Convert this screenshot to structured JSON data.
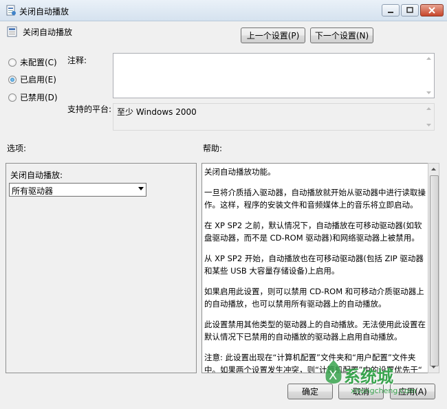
{
  "window": {
    "title": "关闭自动播放"
  },
  "header": {
    "title": "关闭自动播放",
    "prev_label": "上一个设置(P)",
    "next_label": "下一个设置(N)"
  },
  "state": {
    "options": [
      {
        "label": "未配置(C)",
        "checked": false
      },
      {
        "label": "已启用(E)",
        "checked": true
      },
      {
        "label": "已禁用(D)",
        "checked": false
      }
    ]
  },
  "comment": {
    "label": "注释:",
    "value": ""
  },
  "platform": {
    "label": "支持的平台:",
    "value": "至少 Windows 2000"
  },
  "options_section": {
    "label": "选项:",
    "field_label": "关闭自动播放:",
    "selected": "所有驱动器"
  },
  "help_section": {
    "label": "帮助:",
    "paragraphs": [
      "关闭自动播放功能。",
      "一旦将介质插入驱动器，自动播放就开始从驱动器中进行读取操作。这样，程序的安装文件和音频媒体上的音乐将立即启动。",
      "在 XP SP2 之前，默认情况下，自动播放在可移动驱动器(如软盘驱动器，而不是 CD-ROM 驱动器)和网络驱动器上被禁用。",
      "从 XP SP2 开始，自动播放也在可移动驱动器(包括 ZIP 驱动器和某些 USB 大容量存储设备)上启用。",
      "如果启用此设置，则可以禁用 CD-ROM 和可移动介质驱动器上的自动播放，也可以禁用所有驱动器上的自动播放。",
      "此设置禁用其他类型的驱动器上的自动播放。无法使用此设置在默认情况下已禁用的自动播放的驱动器上启用自动播放。",
      "注意: 此设置出现在“计算机配置”文件夹和“用户配置”文件夹中。如果两个设置发生冲突，则“计算机配置”中的设置优先于“"
    ]
  },
  "footer": {
    "ok_label": "确定",
    "cancel_label": "取消",
    "apply_label": "应用(A)"
  },
  "watermark": {
    "main": "系统城",
    "sub": "xitongcheng.com"
  }
}
